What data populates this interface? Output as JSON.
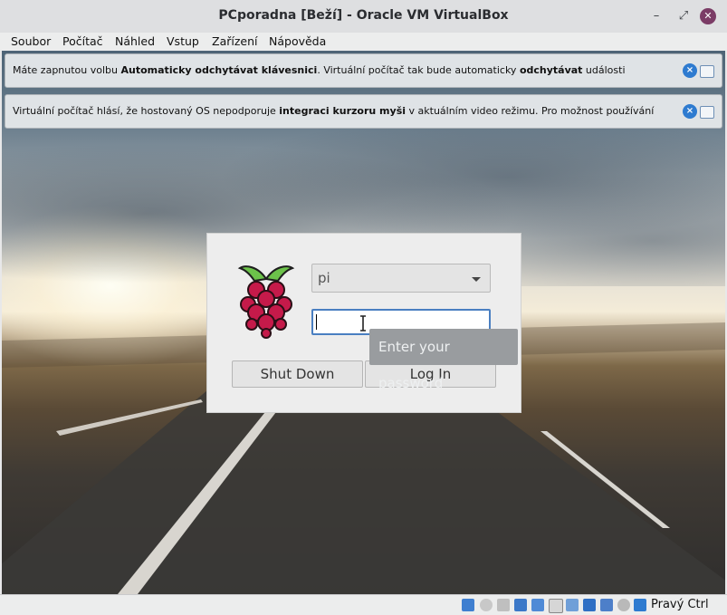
{
  "window": {
    "title": "PCporadna [Beží] - Oracle VM VirtualBox"
  },
  "menu": [
    "Soubor",
    "Počítač",
    "Náhled",
    "Vstup",
    "Zařízení",
    "Nápověda"
  ],
  "notifications": [
    {
      "parts": [
        {
          "text": "Máte zapnutou volbu ",
          "bold": false
        },
        {
          "text": "Automaticky odchytávat klávesnici",
          "bold": true
        },
        {
          "text": ". Virtuální počítač tak bude automaticky ",
          "bold": false
        },
        {
          "text": "odchytávat",
          "bold": true
        },
        {
          "text": " události",
          "bold": false
        }
      ]
    },
    {
      "parts": [
        {
          "text": "Virtuální počítač hlásí, že hostovaný OS nepodporuje ",
          "bold": false
        },
        {
          "text": "integraci kurzoru myši",
          "bold": true
        },
        {
          "text": " v aktuálním video režimu. Pro možnost používání",
          "bold": false
        }
      ]
    }
  ],
  "login": {
    "user_value": "pi",
    "password_value": "",
    "tooltip": "Enter your password",
    "shutdown_label": "Shut Down",
    "login_label": "Log In"
  },
  "status": {
    "host_key": "Pravý Ctrl",
    "icons": [
      "hard-disk-icon",
      "optical-drive-icon",
      "audio-icon",
      "network-icon",
      "usb-icon",
      "shared-folders-icon",
      "display-icon",
      "recording-icon",
      "cpu-icon",
      "mouse-integration-icon",
      "host-key-icon"
    ]
  }
}
